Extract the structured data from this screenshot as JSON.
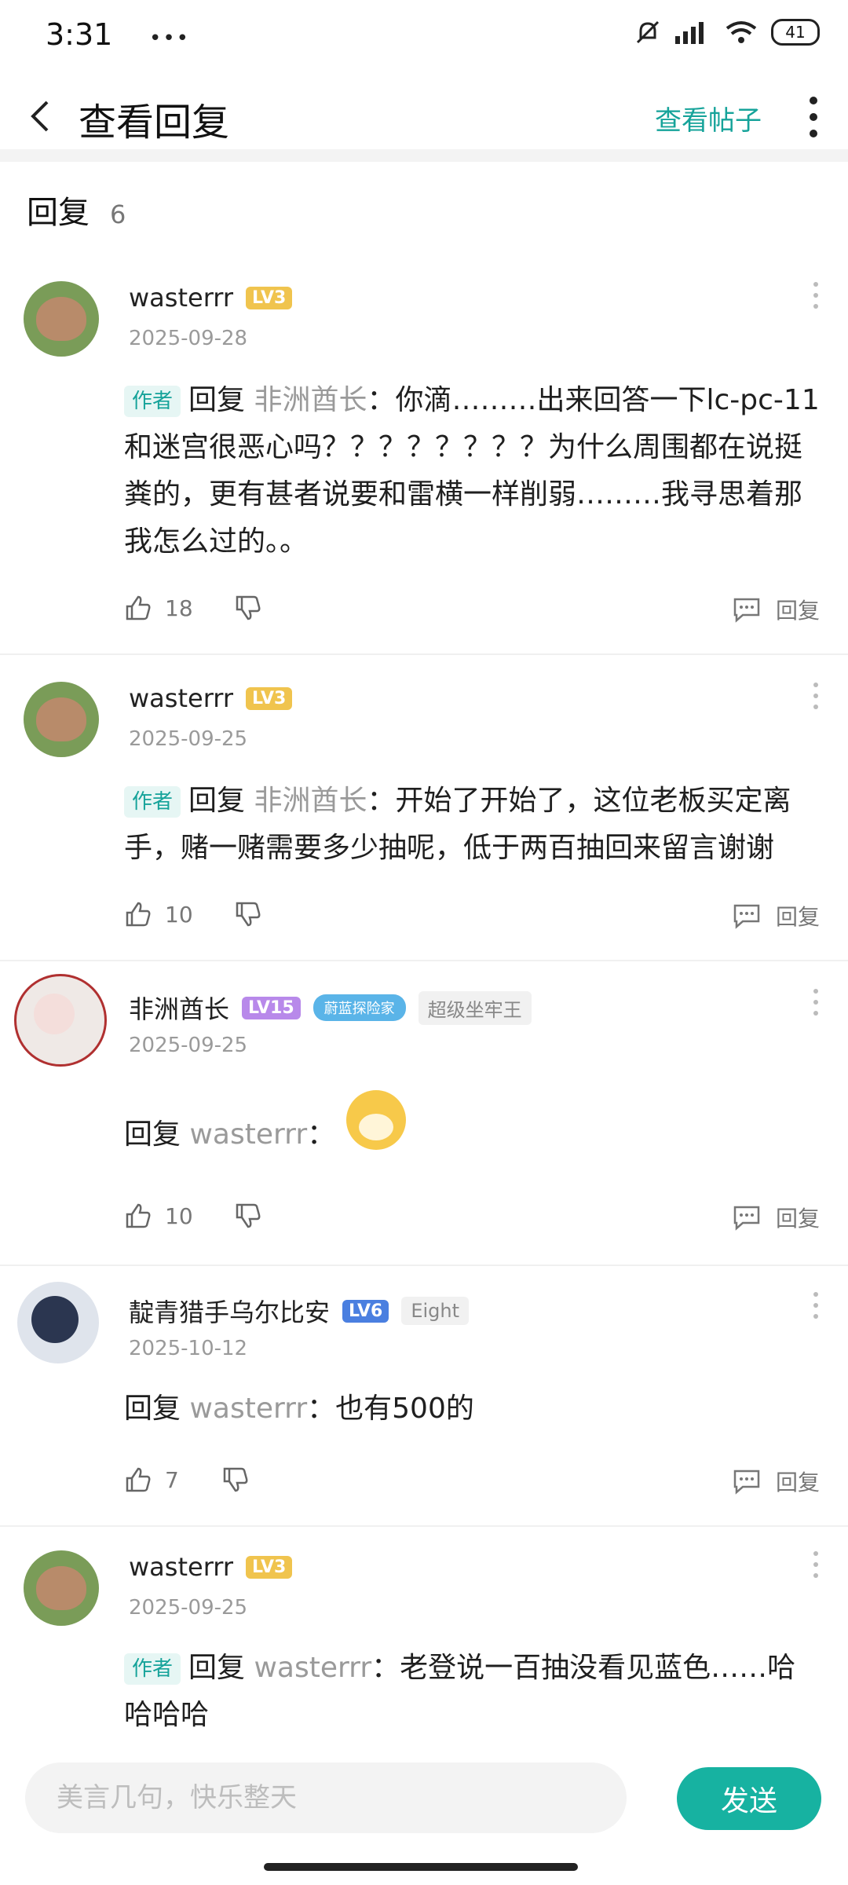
{
  "status": {
    "time": "3:31",
    "battery": "41",
    "icons": [
      "dots-icon",
      "mute-icon",
      "hd-icon",
      "signal-icon",
      "wifi-icon",
      "battery-icon"
    ]
  },
  "header": {
    "title": "查看回复",
    "view_post": "查看帖子"
  },
  "replies": {
    "label": "回复",
    "count": "6"
  },
  "comments": [
    {
      "user": "wasterrr",
      "level": "LV3",
      "date": "2025-09-28",
      "author_badge": "作者",
      "reply_word": "回复",
      "reply_to": "非洲酋长",
      "text": "：你滴………出来回答一下lc-pc-11和迷宫很恶心吗？？？？？？？？为什么周围都在说挺粪的，更有甚者说要和雷横一样削弱………我寻思着那我怎么过的。。",
      "likes": "18",
      "reply_label": "回复"
    },
    {
      "user": "wasterrr",
      "level": "LV3",
      "date": "2025-09-25",
      "author_badge": "作者",
      "reply_word": "回复",
      "reply_to": "非洲酋长",
      "text": "：开始了开始了，这位老板买定离手，赌一赌需要多少抽呢，低于两百抽回来留言谢谢",
      "likes": "10",
      "reply_label": "回复"
    },
    {
      "user": "非洲酋长",
      "level": "LV15",
      "badge": "蔚蓝探险家",
      "tag": "超级坐牢王",
      "date": "2025-09-25",
      "reply_word": "回复",
      "reply_to": "wasterrr",
      "text": "：",
      "likes": "10",
      "reply_label": "回复"
    },
    {
      "user": "靛青猎手乌尔比安",
      "level": "LV6",
      "tag": "Eight",
      "date": "2025-10-12",
      "reply_word": "回复",
      "reply_to": "wasterrr",
      "text": "：也有500的",
      "likes": "7",
      "reply_label": "回复"
    },
    {
      "user": "wasterrr",
      "level": "LV3",
      "date": "2025-09-25",
      "author_badge": "作者",
      "reply_word": "回复",
      "reply_to": "wasterrr",
      "text": "：老登说一百抽没看见蓝色……哈哈哈哈"
    }
  ],
  "composer": {
    "placeholder": "美言几句，快乐整天",
    "send_label": "发送"
  },
  "colors": {
    "accent": "#16a39a",
    "send_bg": "#17b2a1"
  }
}
